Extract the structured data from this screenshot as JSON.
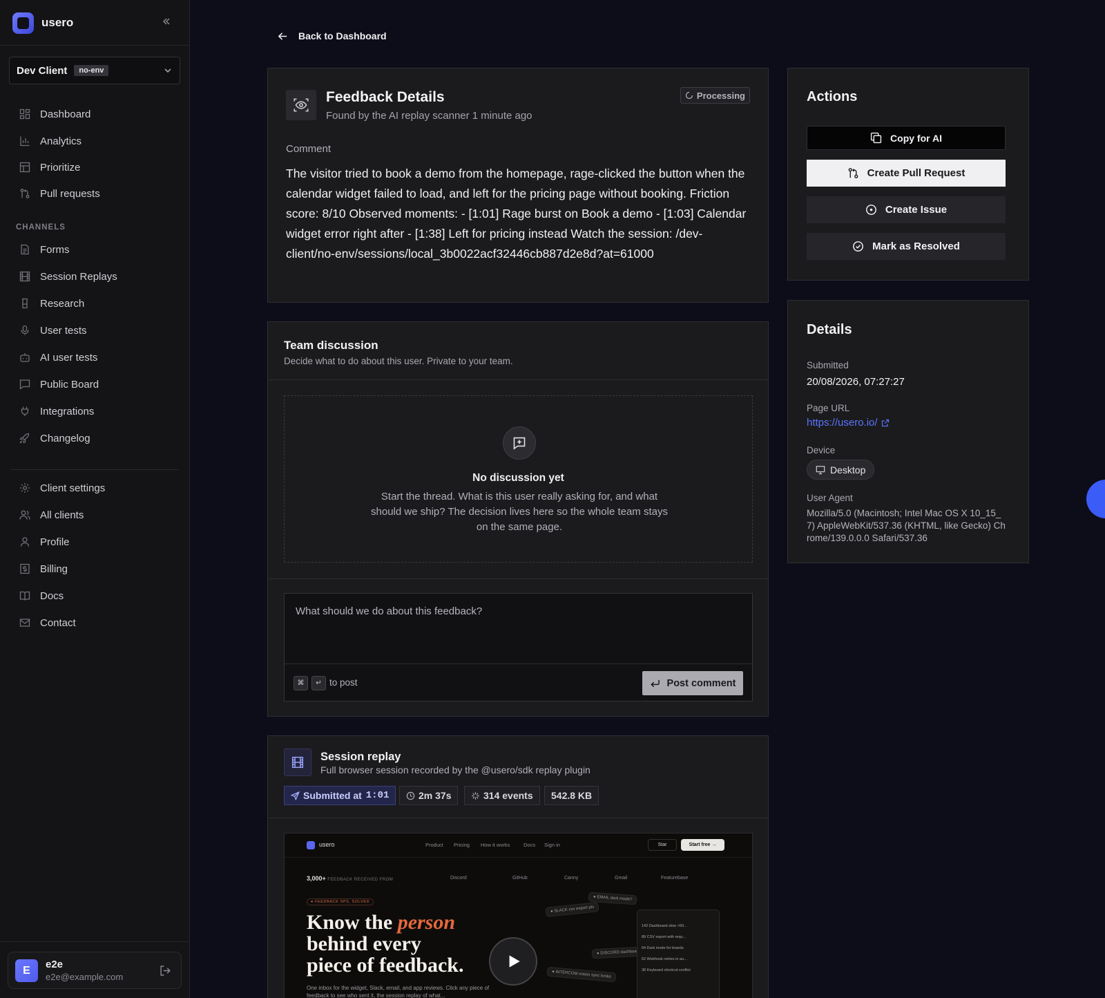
{
  "brand": {
    "name": "usero",
    "accent": "#5b66f0"
  },
  "client": {
    "name": "Dev Client",
    "env": "no-env"
  },
  "nav": {
    "main": [
      {
        "label": "Dashboard",
        "icon": "grid-icon"
      },
      {
        "label": "Analytics",
        "icon": "bar-chart-icon"
      },
      {
        "label": "Prioritize",
        "icon": "table-icon"
      },
      {
        "label": "Pull requests",
        "icon": "git-pull-request-icon"
      }
    ],
    "section_label": "CHANNELS",
    "channels": [
      {
        "label": "Forms",
        "icon": "file-text-icon"
      },
      {
        "label": "Session Replays",
        "icon": "film-icon"
      },
      {
        "label": "Research",
        "icon": "flask-icon"
      },
      {
        "label": "User tests",
        "icon": "mic-icon"
      },
      {
        "label": "AI user tests",
        "icon": "bot-icon"
      },
      {
        "label": "Public Board",
        "icon": "message-square-icon"
      },
      {
        "label": "Integrations",
        "icon": "plug-icon"
      },
      {
        "label": "Changelog",
        "icon": "rocket-icon"
      }
    ],
    "settings": [
      {
        "label": "Client settings",
        "icon": "gear-icon"
      },
      {
        "label": "All clients",
        "icon": "users-icon"
      },
      {
        "label": "Profile",
        "icon": "user-icon"
      },
      {
        "label": "Billing",
        "icon": "dollar-icon"
      },
      {
        "label": "Docs",
        "icon": "book-icon"
      },
      {
        "label": "Contact",
        "icon": "mail-icon"
      }
    ]
  },
  "user": {
    "initial": "E",
    "name": "e2e",
    "email": "e2e@example.com"
  },
  "back_label": "Back to Dashboard",
  "feedback": {
    "title": "Feedback Details",
    "subtitle": "Found by the AI replay scanner 1 minute ago",
    "status": "Processing",
    "comment_label": "Comment",
    "comment": "The visitor tried to book a demo from the homepage, rage-clicked the button when the calendar widget failed to load, and left for the pricing page without booking. Friction score: 8/10 Observed moments: - [1:01] Rage burst on Book a demo - [1:03] Calendar widget error right after - [1:38] Left for pricing instead Watch the session: /dev-client/no-env/sessions/local_3b0022acf32446cb887d2e8d?at=61000"
  },
  "discussion": {
    "title": "Team discussion",
    "subtitle": "Decide what to do about this user. Private to your team.",
    "empty_title": "No discussion yet",
    "empty_text": "Start the thread. What is this user really asking for, and what should we ship? The decision lives here so the whole team stays on the same page.",
    "placeholder": "What should we do about this feedback?",
    "kbd_cmd": "⌘",
    "kbd_enter": "↵",
    "hint": "to post",
    "post_label": "Post comment"
  },
  "replay": {
    "title": "Session replay",
    "subtitle": "Full browser session recorded by the @usero/sdk replay plugin",
    "submitted_label": "Submitted at",
    "submitted_time": "1:01",
    "duration": "2m 37s",
    "events": "314 events",
    "size": "542.8 KB",
    "preview": {
      "brand": "usero",
      "nav": [
        "Product",
        "Pricing",
        "How it works",
        "Docs",
        "Sign in"
      ],
      "star": "Star",
      "start": "Start free →",
      "count": "3,000+",
      "count_label": "FEEDBACK RECEIVED FROM",
      "sources": [
        "Discord",
        "GitHub",
        "Canny",
        "Gmail",
        "Featurebase"
      ],
      "tag": "● FEEDBACK SPS, SOLVED",
      "hero_1": "Know the ",
      "hero_em": "person",
      "hero_2": "behind every",
      "hero_3": "piece of feedback.",
      "small": "One inbox for the widget, Slack, email, and app reviews. Click any piece of feedback to see who sent it, the session replay of what...",
      "cards": [
        "● SLACK  csv export pls",
        "● EMAIL  dark mode?",
        "● DISCORD  dashboard slow",
        "● INTERCOM  notion sync broke"
      ],
      "rows": [
        "142  Dashboard slow >50...",
        "89  CSV export with requ...",
        "64  Dark mode for boards",
        "52  Webhook retries in au...",
        "38  Keyboard shortcut conflict"
      ]
    }
  },
  "actions": {
    "title": "Actions",
    "copy": "Copy for AI",
    "pr": "Create Pull Request",
    "issue": "Create Issue",
    "resolve": "Mark as Resolved"
  },
  "details": {
    "title": "Details",
    "submitted_label": "Submitted",
    "submitted": "20/08/2026, 07:27:27",
    "url_label": "Page URL",
    "url": "https://usero.io/",
    "device_label": "Device",
    "device": "Desktop",
    "ua_label": "User Agent",
    "ua": "Mozilla/5.0 (Macintosh; Intel Mac OS X 10_15_7) AppleWebKit/537.36 (KHTML, like Gecko) Chrome/139.0.0.0 Safari/537.36"
  }
}
